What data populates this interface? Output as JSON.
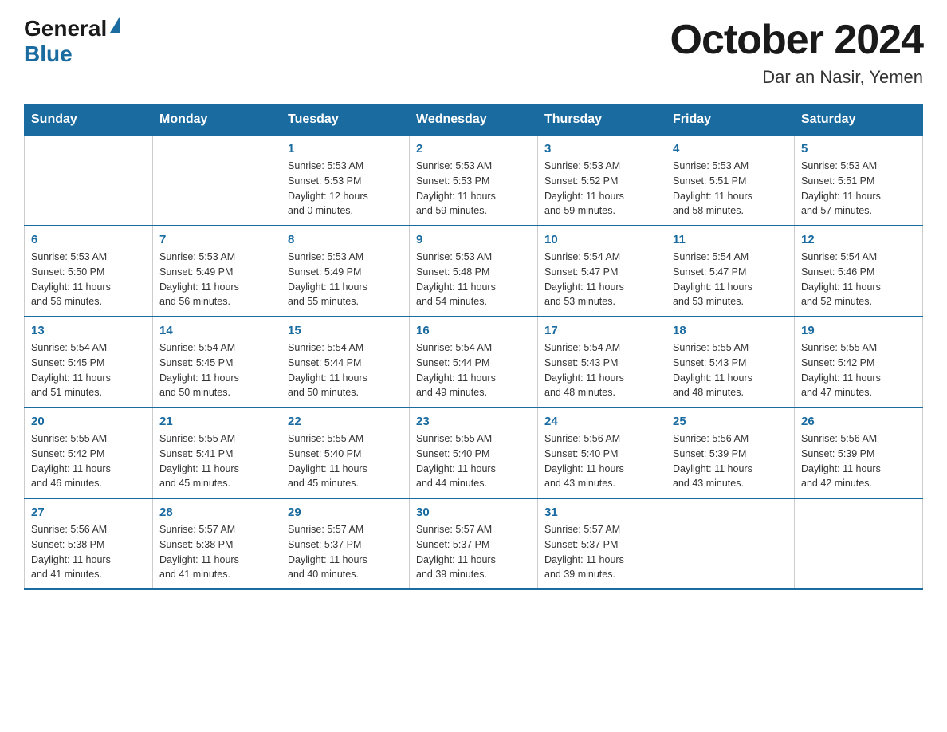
{
  "header": {
    "logo": {
      "general_text": "General",
      "blue_text": "Blue"
    },
    "title": "October 2024",
    "location": "Dar an Nasir, Yemen"
  },
  "days_of_week": [
    "Sunday",
    "Monday",
    "Tuesday",
    "Wednesday",
    "Thursday",
    "Friday",
    "Saturday"
  ],
  "weeks": [
    [
      {
        "day": "",
        "info": ""
      },
      {
        "day": "",
        "info": ""
      },
      {
        "day": "1",
        "info": "Sunrise: 5:53 AM\nSunset: 5:53 PM\nDaylight: 12 hours\nand 0 minutes."
      },
      {
        "day": "2",
        "info": "Sunrise: 5:53 AM\nSunset: 5:53 PM\nDaylight: 11 hours\nand 59 minutes."
      },
      {
        "day": "3",
        "info": "Sunrise: 5:53 AM\nSunset: 5:52 PM\nDaylight: 11 hours\nand 59 minutes."
      },
      {
        "day": "4",
        "info": "Sunrise: 5:53 AM\nSunset: 5:51 PM\nDaylight: 11 hours\nand 58 minutes."
      },
      {
        "day": "5",
        "info": "Sunrise: 5:53 AM\nSunset: 5:51 PM\nDaylight: 11 hours\nand 57 minutes."
      }
    ],
    [
      {
        "day": "6",
        "info": "Sunrise: 5:53 AM\nSunset: 5:50 PM\nDaylight: 11 hours\nand 56 minutes."
      },
      {
        "day": "7",
        "info": "Sunrise: 5:53 AM\nSunset: 5:49 PM\nDaylight: 11 hours\nand 56 minutes."
      },
      {
        "day": "8",
        "info": "Sunrise: 5:53 AM\nSunset: 5:49 PM\nDaylight: 11 hours\nand 55 minutes."
      },
      {
        "day": "9",
        "info": "Sunrise: 5:53 AM\nSunset: 5:48 PM\nDaylight: 11 hours\nand 54 minutes."
      },
      {
        "day": "10",
        "info": "Sunrise: 5:54 AM\nSunset: 5:47 PM\nDaylight: 11 hours\nand 53 minutes."
      },
      {
        "day": "11",
        "info": "Sunrise: 5:54 AM\nSunset: 5:47 PM\nDaylight: 11 hours\nand 53 minutes."
      },
      {
        "day": "12",
        "info": "Sunrise: 5:54 AM\nSunset: 5:46 PM\nDaylight: 11 hours\nand 52 minutes."
      }
    ],
    [
      {
        "day": "13",
        "info": "Sunrise: 5:54 AM\nSunset: 5:45 PM\nDaylight: 11 hours\nand 51 minutes."
      },
      {
        "day": "14",
        "info": "Sunrise: 5:54 AM\nSunset: 5:45 PM\nDaylight: 11 hours\nand 50 minutes."
      },
      {
        "day": "15",
        "info": "Sunrise: 5:54 AM\nSunset: 5:44 PM\nDaylight: 11 hours\nand 50 minutes."
      },
      {
        "day": "16",
        "info": "Sunrise: 5:54 AM\nSunset: 5:44 PM\nDaylight: 11 hours\nand 49 minutes."
      },
      {
        "day": "17",
        "info": "Sunrise: 5:54 AM\nSunset: 5:43 PM\nDaylight: 11 hours\nand 48 minutes."
      },
      {
        "day": "18",
        "info": "Sunrise: 5:55 AM\nSunset: 5:43 PM\nDaylight: 11 hours\nand 48 minutes."
      },
      {
        "day": "19",
        "info": "Sunrise: 5:55 AM\nSunset: 5:42 PM\nDaylight: 11 hours\nand 47 minutes."
      }
    ],
    [
      {
        "day": "20",
        "info": "Sunrise: 5:55 AM\nSunset: 5:42 PM\nDaylight: 11 hours\nand 46 minutes."
      },
      {
        "day": "21",
        "info": "Sunrise: 5:55 AM\nSunset: 5:41 PM\nDaylight: 11 hours\nand 45 minutes."
      },
      {
        "day": "22",
        "info": "Sunrise: 5:55 AM\nSunset: 5:40 PM\nDaylight: 11 hours\nand 45 minutes."
      },
      {
        "day": "23",
        "info": "Sunrise: 5:55 AM\nSunset: 5:40 PM\nDaylight: 11 hours\nand 44 minutes."
      },
      {
        "day": "24",
        "info": "Sunrise: 5:56 AM\nSunset: 5:40 PM\nDaylight: 11 hours\nand 43 minutes."
      },
      {
        "day": "25",
        "info": "Sunrise: 5:56 AM\nSunset: 5:39 PM\nDaylight: 11 hours\nand 43 minutes."
      },
      {
        "day": "26",
        "info": "Sunrise: 5:56 AM\nSunset: 5:39 PM\nDaylight: 11 hours\nand 42 minutes."
      }
    ],
    [
      {
        "day": "27",
        "info": "Sunrise: 5:56 AM\nSunset: 5:38 PM\nDaylight: 11 hours\nand 41 minutes."
      },
      {
        "day": "28",
        "info": "Sunrise: 5:57 AM\nSunset: 5:38 PM\nDaylight: 11 hours\nand 41 minutes."
      },
      {
        "day": "29",
        "info": "Sunrise: 5:57 AM\nSunset: 5:37 PM\nDaylight: 11 hours\nand 40 minutes."
      },
      {
        "day": "30",
        "info": "Sunrise: 5:57 AM\nSunset: 5:37 PM\nDaylight: 11 hours\nand 39 minutes."
      },
      {
        "day": "31",
        "info": "Sunrise: 5:57 AM\nSunset: 5:37 PM\nDaylight: 11 hours\nand 39 minutes."
      },
      {
        "day": "",
        "info": ""
      },
      {
        "day": "",
        "info": ""
      }
    ]
  ]
}
